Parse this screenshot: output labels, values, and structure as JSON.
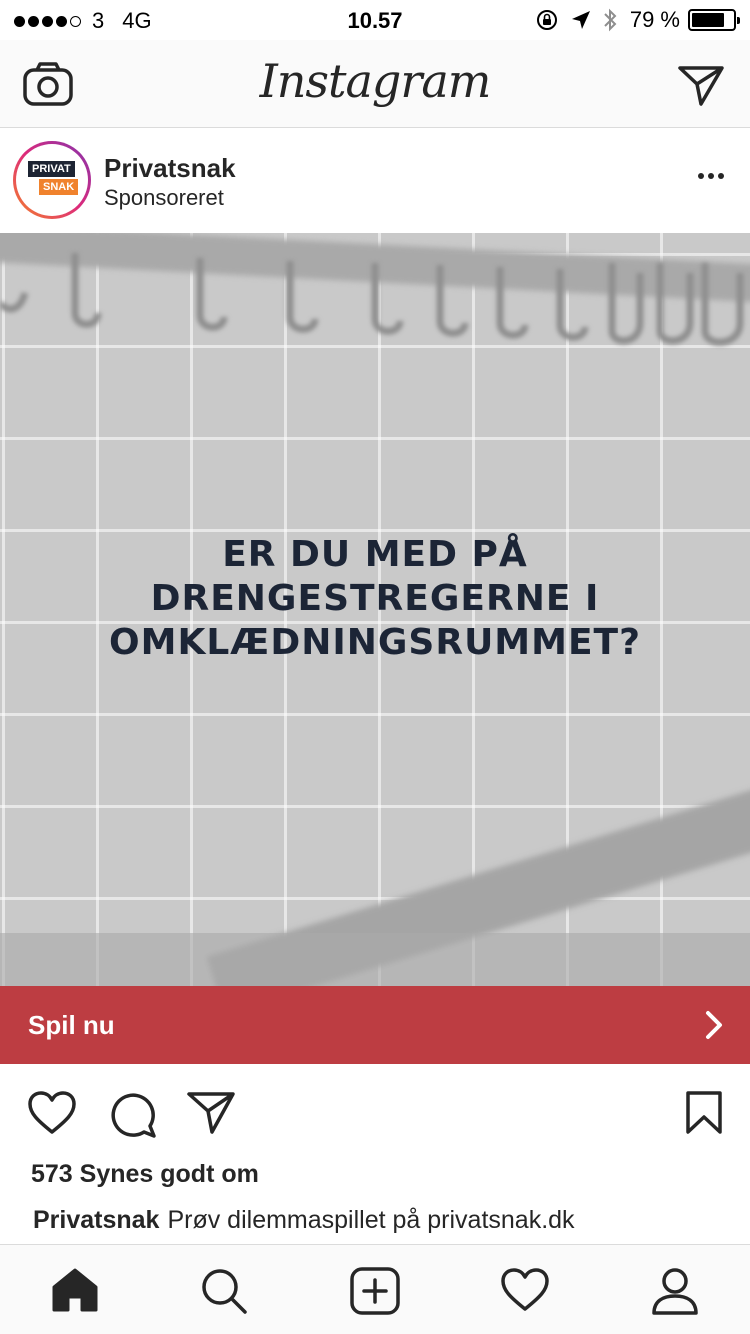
{
  "status_bar": {
    "carrier": "3",
    "network": "4G",
    "time": "10.57",
    "battery": "79 %",
    "battery_level": 0.79,
    "signal_bars_filled": 4,
    "signal_bars_total": 5
  },
  "header": {
    "logo": "Instagram",
    "camera_icon": "camera-icon",
    "direct_icon": "paper-plane-icon"
  },
  "post": {
    "username": "Privatsnak",
    "sponsored_label": "Sponsoreret",
    "avatar": {
      "line1": "PRIVAT",
      "line2": "SNAK"
    },
    "headline": "ER DU MED PÅ\nDRENGESTREGERNE I\nOMKLÆDNINGSRUMMET?",
    "cta_label": "Spil nu",
    "likes": "573 Synes godt om",
    "caption_user": "Privatsnak",
    "caption_text": "Prøv dilemmaspillet på privatsnak.dk"
  },
  "colors": {
    "cta_background": "#bd3d42",
    "headline": "#1c2536",
    "text": "#262626"
  },
  "tab_bar": {
    "items": [
      "home-icon",
      "search-icon",
      "add-icon",
      "heart-icon",
      "profile-icon"
    ],
    "active": "home-icon"
  }
}
